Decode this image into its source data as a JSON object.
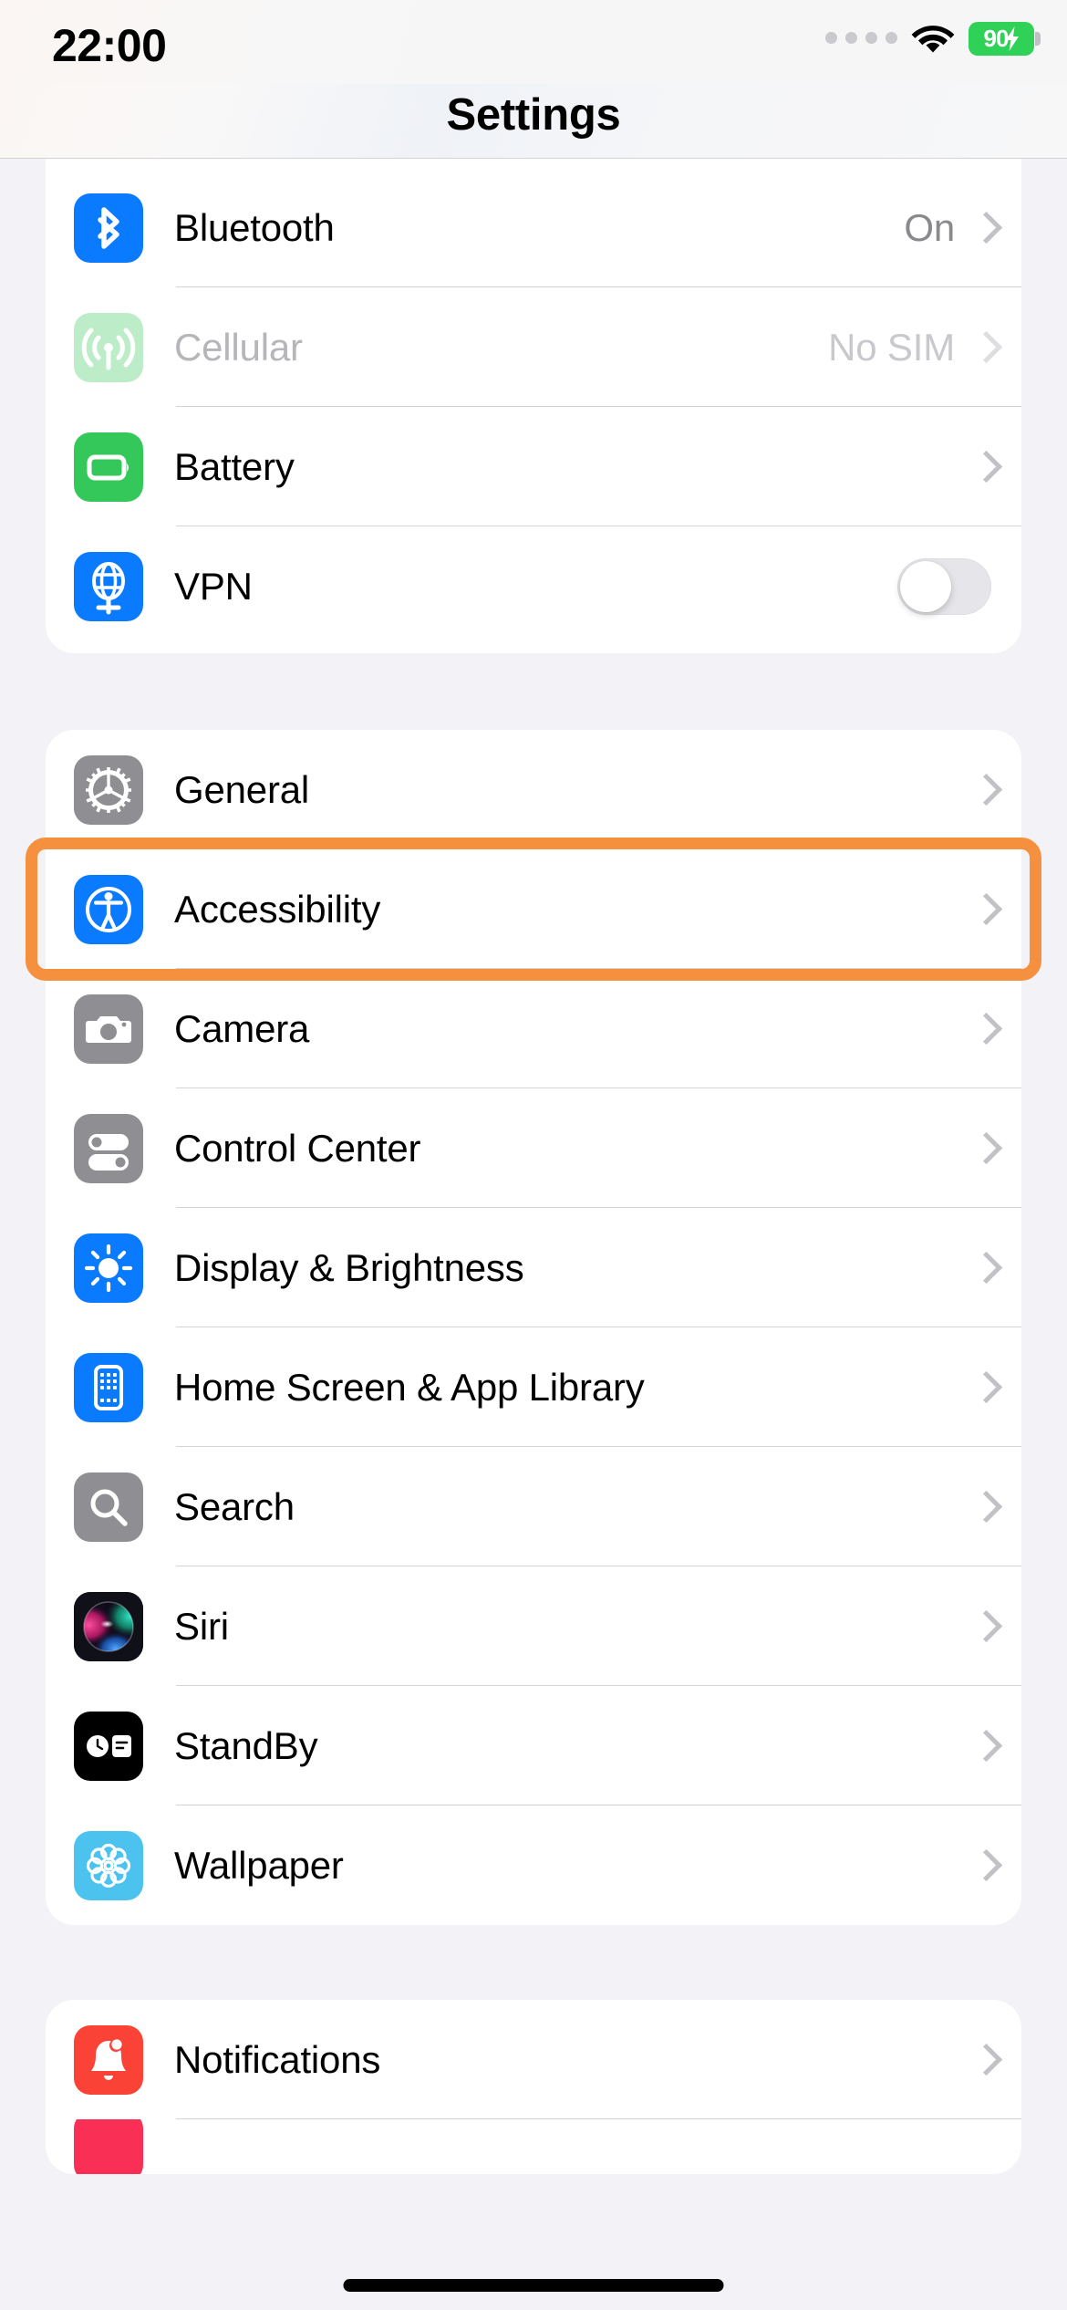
{
  "status_bar": {
    "time": "22:00",
    "signal_icon": "signal-dots-icon",
    "wifi_icon": "wifi-icon",
    "battery_percent": "90",
    "battery_charging": true,
    "battery_color": "#2FD257"
  },
  "header": {
    "title": "Settings"
  },
  "highlight": {
    "color": "#F5913E",
    "target": "Accessibility"
  },
  "groups": [
    {
      "id": "connectivity",
      "rows": [
        {
          "label": "Bluetooth",
          "value": "On",
          "accessory": "chevron",
          "icon": "bluetooth-icon",
          "icon_color": "#0A7AFF",
          "dim": false
        },
        {
          "label": "Cellular",
          "value": "No SIM",
          "accessory": "chevron",
          "icon": "cellular-icon",
          "icon_color": "#34C759",
          "dim": true
        },
        {
          "label": "Battery",
          "value": "",
          "accessory": "chevron",
          "icon": "battery-icon",
          "icon_color": "#34C759",
          "dim": false
        },
        {
          "label": "VPN",
          "value": "",
          "accessory": "toggle",
          "toggle_on": false,
          "icon": "vpn-globe-icon",
          "icon_color": "#0A7AFF",
          "dim": false
        }
      ]
    },
    {
      "id": "system",
      "rows": [
        {
          "label": "General",
          "value": "",
          "accessory": "chevron",
          "icon": "gear-icon",
          "icon_color": "#8E8E93",
          "dim": false
        },
        {
          "label": "Accessibility",
          "value": "",
          "accessory": "chevron",
          "icon": "accessibility-icon",
          "icon_color": "#0A7AFF",
          "dim": false,
          "highlighted": true
        },
        {
          "label": "Camera",
          "value": "",
          "accessory": "chevron",
          "icon": "camera-icon",
          "icon_color": "#8E8E93",
          "dim": false
        },
        {
          "label": "Control Center",
          "value": "",
          "accessory": "chevron",
          "icon": "control-center-icon",
          "icon_color": "#8E8E93",
          "dim": false
        },
        {
          "label": "Display & Brightness",
          "value": "",
          "accessory": "chevron",
          "icon": "brightness-icon",
          "icon_color": "#0A7AFF",
          "dim": false
        },
        {
          "label": "Home Screen & App Library",
          "value": "",
          "accessory": "chevron",
          "icon": "home-screen-icon",
          "icon_color": "#0A7AFF",
          "dim": false
        },
        {
          "label": "Search",
          "value": "",
          "accessory": "chevron",
          "icon": "search-icon",
          "icon_color": "#8E8E93",
          "dim": false
        },
        {
          "label": "Siri",
          "value": "",
          "accessory": "chevron",
          "icon": "siri-icon",
          "icon_color": "#1D1D2E",
          "dim": false
        },
        {
          "label": "StandBy",
          "value": "",
          "accessory": "chevron",
          "icon": "standby-icon",
          "icon_color": "#000000",
          "dim": false
        },
        {
          "label": "Wallpaper",
          "value": "",
          "accessory": "chevron",
          "icon": "wallpaper-icon",
          "icon_color": "#4CC3EE",
          "dim": false
        }
      ]
    },
    {
      "id": "notifications",
      "rows": [
        {
          "label": "Notifications",
          "value": "",
          "accessory": "chevron",
          "icon": "bell-icon",
          "icon_color": "#FA4336",
          "dim": false
        }
      ]
    }
  ]
}
